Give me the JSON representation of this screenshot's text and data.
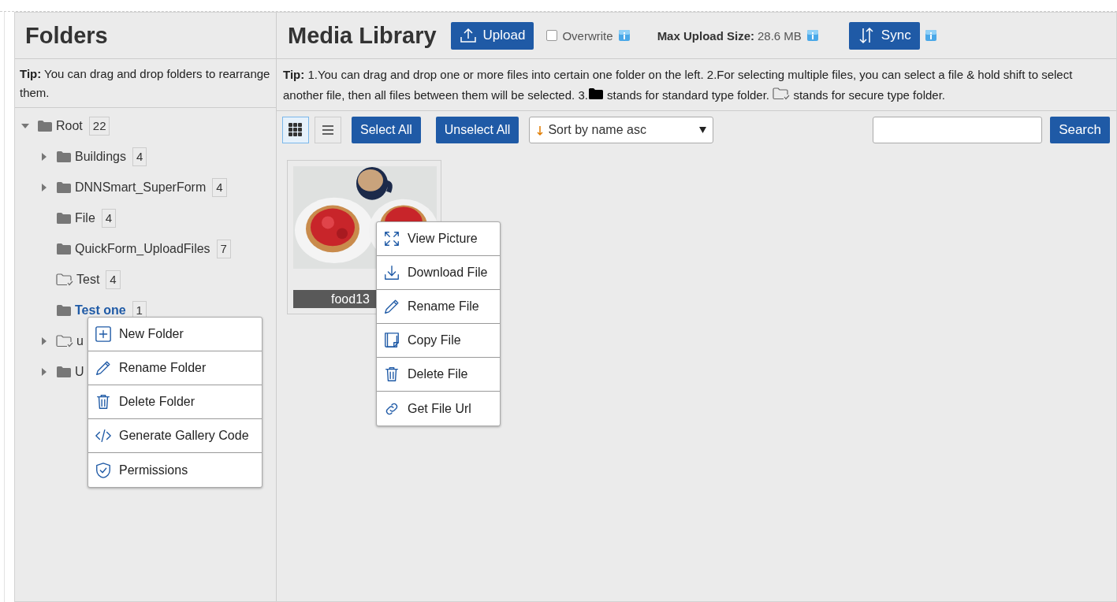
{
  "folders_panel": {
    "title": "Folders",
    "tip": "**Tip:** You can drag and drop folders to rearrange them.",
    "tree": [
      {
        "name": "Root",
        "count": "22",
        "kind": "standard",
        "expandable": true,
        "expanded": true,
        "selected": false,
        "children": [
          {
            "name": "Buildings",
            "count": "4",
            "kind": "standard",
            "expandable": true,
            "expanded": false,
            "selected": false
          },
          {
            "name": "DNNSmart_SuperForm",
            "count": "4",
            "kind": "standard",
            "expandable": true,
            "expanded": false,
            "selected": false
          },
          {
            "name": "File",
            "count": "4",
            "kind": "standard",
            "expandable": false,
            "expanded": false,
            "selected": false
          },
          {
            "name": "QuickForm_UploadFiles",
            "count": "7",
            "kind": "standard",
            "expandable": false,
            "expanded": false,
            "selected": false
          },
          {
            "name": "Test",
            "count": "4",
            "kind": "secure",
            "expandable": false,
            "expanded": false,
            "selected": false
          },
          {
            "name": "Test one",
            "count": "1",
            "kind": "standard",
            "expandable": false,
            "expanded": false,
            "selected": true
          },
          {
            "name": "u",
            "kind": "secure",
            "expandable": true,
            "expanded": false,
            "selected": false
          },
          {
            "name": "U",
            "kind": "standard",
            "expandable": true,
            "expanded": false,
            "selected": false
          }
        ]
      }
    ],
    "context_menu": [
      "New Folder",
      "Rename Folder",
      "Delete Folder",
      "Generate Gallery Code",
      "Permissions"
    ]
  },
  "media_panel": {
    "title": "Media Library",
    "upload_button": "Upload",
    "overwrite": {
      "label": "Overwrite",
      "checked": false
    },
    "max_upload_label": "Max Upload Size:",
    "max_upload_value": "28.6 MB",
    "sync_button": "Sync",
    "tip": [
      "**Tip:** 1.You can drag and drop one or more files into certain one folder on the left. 2.For selecting multiple files, you can select a file & hold shift to select another file, then all files between them will be selected. 3.",
      "stands for standard type folder.",
      "stands for secure type folder."
    ],
    "view_modes": [
      {
        "kind": "grid",
        "selected": true
      },
      {
        "kind": "list",
        "selected": false
      }
    ],
    "select_all_button": "Select All",
    "unselect_all_button": "Unselect All",
    "sort": "Sort by name asc",
    "search_button": "Search",
    "files": [
      {
        "kind": "picture",
        "name": "food13"
      }
    ],
    "context_menu": [
      "View Picture",
      "Download File",
      "Rename File",
      "Copy File",
      "Delete File",
      "Get File Url"
    ]
  }
}
